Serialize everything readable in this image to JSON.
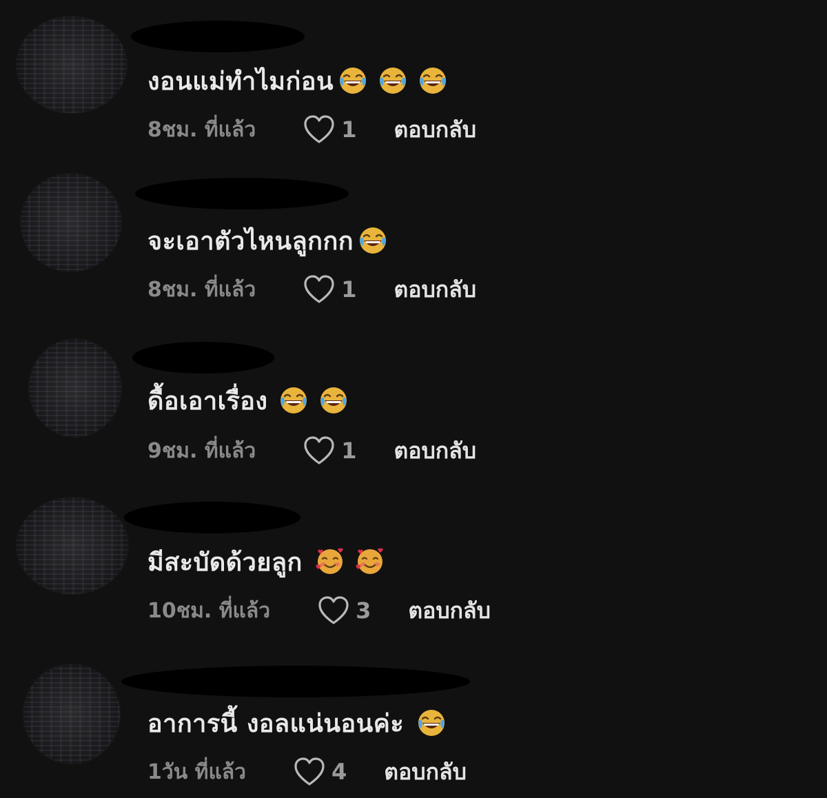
{
  "comments": [
    {
      "text": "งอนแม่ทำไมก่อน",
      "emojis": [
        "tears-of-joy",
        "tears-of-joy",
        "tears-of-joy"
      ],
      "timestamp": "8ชม. ที่แล้ว",
      "likes": "1",
      "reply_label": "ตอบกลับ"
    },
    {
      "text": "จะเอาตัวไหนลูกกก",
      "emojis": [
        "tears-of-joy"
      ],
      "timestamp": "8ชม. ที่แล้ว",
      "likes": "1",
      "reply_label": "ตอบกลับ"
    },
    {
      "text": "ดื้อเอาเรื่อง",
      "emojis": [
        "tears-of-joy",
        "tears-of-joy"
      ],
      "timestamp": "9ชม. ที่แล้ว",
      "likes": "1",
      "reply_label": "ตอบกลับ"
    },
    {
      "text": "มีสะบัดด้วยลูก",
      "emojis": [
        "smiling-face-with-hearts",
        "smiling-face-with-hearts"
      ],
      "timestamp": "10ชม. ที่แล้ว",
      "likes": "3",
      "reply_label": "ตอบกลับ"
    },
    {
      "text": "อาการนี้ งอลแน่นอนค่ะ",
      "emojis": [
        "tears-of-joy"
      ],
      "timestamp": "1วัน ที่แล้ว",
      "likes": "4",
      "reply_label": "ตอบกลับ"
    }
  ],
  "icons": {
    "like": "heart-outline-icon"
  },
  "colors": {
    "background": "#111111",
    "comment_text": "#e9e9e9",
    "meta_text": "#8a8a8a",
    "reply_text": "#e4e4e4"
  }
}
